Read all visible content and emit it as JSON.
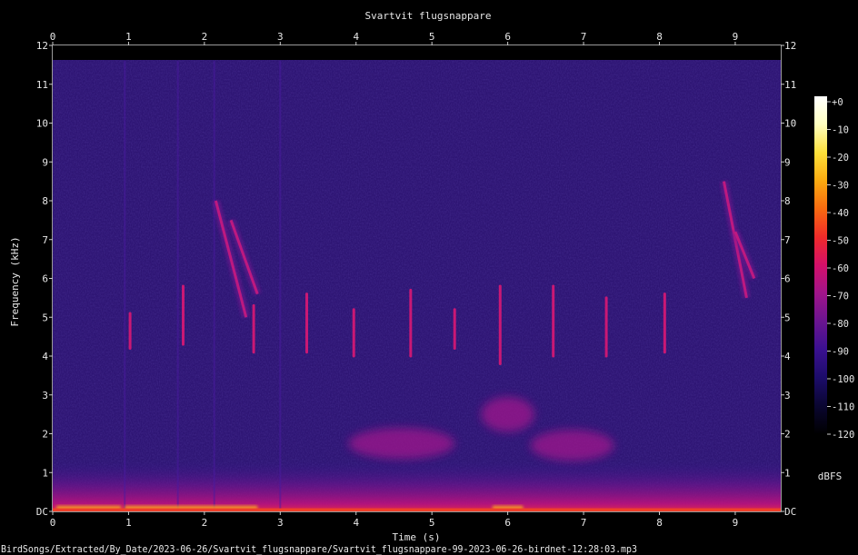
{
  "chart_data": {
    "type": "heatmap",
    "title": "Svartvit flugsnappare",
    "xlabel": "Time (s)",
    "ylabel": "Frequency (kHz)",
    "xlim": [
      0,
      9.6
    ],
    "ylim": [
      0,
      12
    ],
    "x_ticks": [
      "0",
      "1",
      "2",
      "3",
      "4",
      "5",
      "6",
      "7",
      "8",
      "9"
    ],
    "y_ticks": [
      "DC",
      "1",
      "2",
      "3",
      "4",
      "5",
      "6",
      "7",
      "8",
      "9",
      "10",
      "11",
      "12"
    ],
    "colorbar": {
      "label": "dBFS",
      "range": [
        -120,
        0
      ],
      "ticks": [
        "+0",
        "-10",
        "-20",
        "-30",
        "-40",
        "-50",
        "-60",
        "-70",
        "-80",
        "-90",
        "-100",
        "-110",
        "-120"
      ],
      "colors": [
        "#000000",
        "#0a0630",
        "#1c0c6a",
        "#3a1090",
        "#6a1490",
        "#a0148a",
        "#d4106a",
        "#f02a2a",
        "#f86a10",
        "#fbaa10",
        "#fde03a",
        "#ffffc0",
        "#ffffff"
      ]
    },
    "background_level": "#2e1574",
    "grid": false,
    "calls": [
      {
        "t": 1.02,
        "f_low": 4.2,
        "f_high": 5.1
      },
      {
        "t": 1.72,
        "f_low": 4.3,
        "f_high": 5.8
      },
      {
        "t": 2.65,
        "f_low": 4.1,
        "f_high": 5.3
      },
      {
        "t": 3.35,
        "f_low": 4.1,
        "f_high": 5.6
      },
      {
        "t": 3.97,
        "f_low": 4.0,
        "f_high": 5.2
      },
      {
        "t": 4.72,
        "f_low": 4.0,
        "f_high": 5.7
      },
      {
        "t": 5.3,
        "f_low": 4.2,
        "f_high": 5.2
      },
      {
        "t": 5.9,
        "f_low": 3.8,
        "f_high": 5.8
      },
      {
        "t": 6.6,
        "f_low": 4.0,
        "f_high": 5.8
      },
      {
        "t": 7.3,
        "f_low": 4.0,
        "f_high": 5.5
      },
      {
        "t": 8.07,
        "f_low": 4.1,
        "f_high": 5.6
      }
    ],
    "sweeps": [
      {
        "t0": 2.15,
        "f0": 8.0,
        "t1": 2.55,
        "f1": 5.0
      },
      {
        "t0": 2.35,
        "f0": 7.5,
        "t1": 2.7,
        "f1": 5.6
      },
      {
        "t0": 8.85,
        "f0": 8.5,
        "t1": 9.15,
        "f1": 5.5
      },
      {
        "t0": 9.0,
        "f0": 7.2,
        "t1": 9.25,
        "f1": 6.0
      }
    ],
    "blobs": [
      {
        "t": 6.0,
        "f": 2.5,
        "dt": 0.35,
        "df": 0.45
      },
      {
        "t": 4.6,
        "f": 1.75,
        "dt": 0.7,
        "df": 0.4
      },
      {
        "t": 6.85,
        "f": 1.7,
        "dt": 0.55,
        "df": 0.4
      }
    ]
  },
  "footer": {
    "path": "BirdSongs/Extracted/By_Date/2023-06-26/Svartvit_flugsnappare/Svartvit_flugsnappare-99-2023-06-26-birdnet-12:28:03.mp3"
  }
}
